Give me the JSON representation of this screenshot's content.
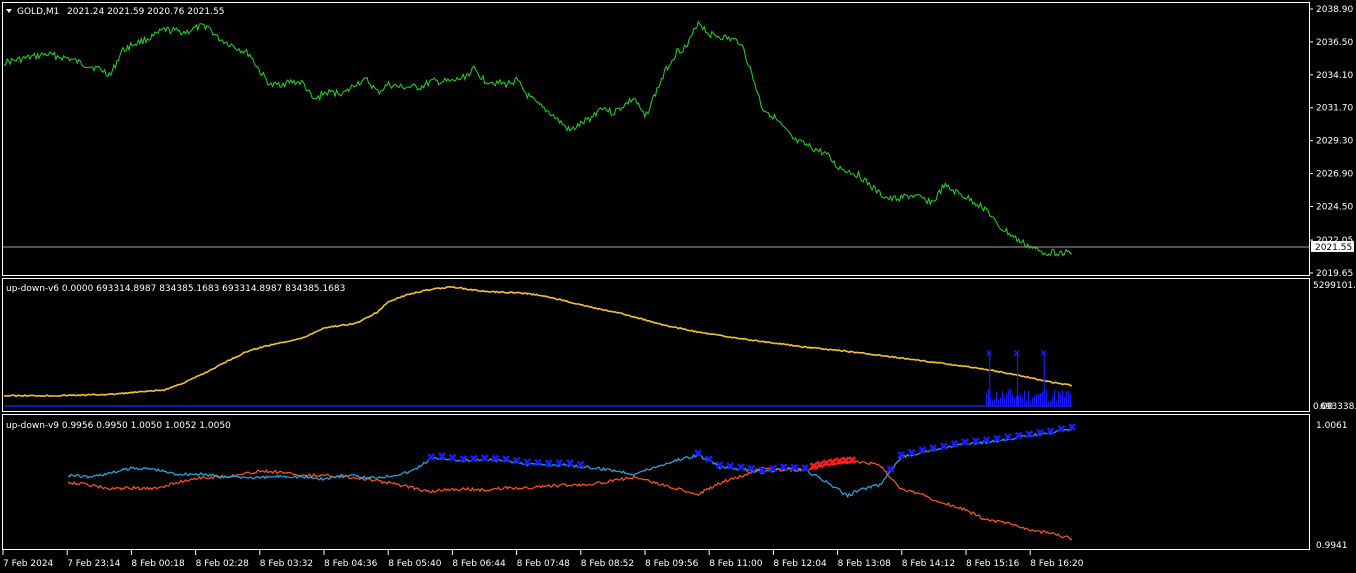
{
  "colors": {
    "background": "#000000",
    "frame": "#ffffff",
    "price_line": "#1fd81f",
    "yellow_line": "#f2c233",
    "blue_marker": "#1a1aff",
    "sky_line": "#29a8e6",
    "orange_line": "#ff5520",
    "red_marker": "#ff1a1a",
    "current_price_label_bg": "#ffffff"
  },
  "chart_data": [
    {
      "type": "line",
      "panel": "main",
      "header": {
        "symbol": "GOLD,M1",
        "ohlc": "2021.24 2021.59 2020.76 2021.55"
      },
      "current_price": "2021.55",
      "y_ticks": [
        "2038.90",
        "2036.50",
        "2034.10",
        "2031.70",
        "2029.30",
        "2026.90",
        "2024.50",
        "2022.05",
        "2019.65"
      ],
      "ylim": [
        2019.65,
        2038.9
      ],
      "x": [
        0,
        2,
        4,
        6,
        7,
        9,
        10,
        11,
        12,
        14,
        15,
        16,
        17,
        18,
        19,
        20,
        22,
        23,
        24,
        25,
        27,
        28,
        29,
        30,
        32,
        33,
        34,
        35,
        36,
        37,
        39,
        40,
        42,
        43,
        44,
        45,
        47,
        48,
        49,
        50,
        51,
        53,
        55,
        56,
        57,
        59,
        60,
        62,
        63,
        64,
        65,
        66,
        67,
        69,
        70,
        71,
        72,
        73,
        74,
        75,
        77,
        78,
        80,
        82,
        83,
        85,
        87,
        88,
        90,
        92,
        93,
        94,
        95,
        97,
        100
      ],
      "values": [
        2035.0,
        2035.3,
        2035.6,
        2035.3,
        2035.0,
        2034.5,
        2034.1,
        2035.8,
        2036.3,
        2036.9,
        2037.4,
        2037.3,
        2037.2,
        2037.5,
        2037.7,
        2036.8,
        2036.0,
        2035.6,
        2034.3,
        2033.3,
        2033.6,
        2033.5,
        2032.2,
        2032.8,
        2032.8,
        2033.5,
        2033.7,
        2032.8,
        2033.4,
        2033.2,
        2033.2,
        2033.6,
        2033.6,
        2033.9,
        2034.5,
        2033.7,
        2033.4,
        2033.7,
        2032.6,
        2031.9,
        2031.4,
        2030.0,
        2031.0,
        2031.8,
        2031.3,
        2032.4,
        2031.0,
        2034.5,
        2035.8,
        2036.2,
        2038.0,
        2037.1,
        2036.9,
        2036.5,
        2034.2,
        2031.7,
        2031.1,
        2030.2,
        2029.3,
        2029.0,
        2028.3,
        2027.4,
        2026.8,
        2025.4,
        2025.0,
        2025.3,
        2024.8,
        2026.0,
        2025.2,
        2024.3,
        2023.1,
        2022.6,
        2022.0,
        2021.2,
        2021.1
      ]
    },
    {
      "type": "line",
      "panel": "indicator-1",
      "header": "up-down-v6 0.0000 693314.8987 834385.1683 693314.8987 834385.1683",
      "y_ticks": [
        "5299101.9",
        "0.00",
        "693338.1"
      ],
      "ylim": [
        0,
        5299101.9
      ],
      "series": [
        {
          "x": [
            0,
            5,
            10,
            15,
            17,
            19,
            21,
            23,
            25,
            28,
            30,
            33,
            35,
            36,
            38,
            40,
            42,
            45,
            48,
            50,
            52,
            55,
            58,
            60,
            62,
            65,
            70,
            75,
            80,
            85,
            90,
            92,
            95,
            98,
            100
          ],
          "values": [
            500000,
            500000,
            560000,
            750000,
            1100000,
            1550000,
            2050000,
            2500000,
            2750000,
            3050000,
            3500000,
            3700000,
            4200000,
            4650000,
            5000000,
            5200000,
            5300000,
            5100000,
            5050000,
            4950000,
            4750000,
            4400000,
            4100000,
            3850000,
            3600000,
            3300000,
            2950000,
            2650000,
            2400000,
            2100000,
            1800000,
            1650000,
            1400000,
            1100000,
            950000
          ]
        }
      ],
      "markers": {
        "x": [
          92.3,
          94.9,
          97.4
        ],
        "label": "x"
      }
    },
    {
      "type": "line",
      "panel": "indicator-2",
      "header": "up-down-v9 0.9956 0.9950 1.0050 1.0052 1.0050",
      "y_ticks": [
        "1.0061",
        "0.9941"
      ],
      "ylim": [
        0.9941,
        1.0061
      ],
      "series": [
        {
          "x": [
            6,
            8,
            10,
            12,
            14,
            16,
            18,
            20,
            22,
            24,
            26,
            28,
            30,
            32,
            34,
            36,
            38,
            40,
            41,
            43,
            45,
            47,
            49,
            51,
            53,
            55,
            57,
            59,
            61,
            63,
            65,
            67,
            69,
            71,
            73,
            75,
            77,
            79,
            80,
            82,
            84,
            86,
            88,
            90,
            92,
            94,
            96,
            98,
            100
          ],
          "values": [
            1.0011,
            1.0009,
            1.0013,
            1.0018,
            1.0017,
            1.0012,
            1.0012,
            1.001,
            1.0009,
            1.0008,
            1.001,
            1.0009,
            1.0007,
            1.0011,
            1.0008,
            1.001,
            1.0014,
            1.0027,
            1.0028,
            1.0025,
            1.0026,
            1.0025,
            1.0022,
            1.0021,
            1.0021,
            1.0018,
            1.0016,
            1.0012,
            1.0019,
            1.0026,
            1.0031,
            1.0019,
            1.0017,
            1.0014,
            1.0017,
            1.0016,
            1.0004,
            0.999,
            0.9996,
            1.0001,
            1.0029,
            1.0034,
            1.0038,
            1.0042,
            1.0044,
            1.0047,
            1.005,
            1.0053,
            1.0057
          ]
        },
        {
          "x": [
            6,
            8,
            10,
            12,
            14,
            16,
            18,
            20,
            22,
            24,
            26,
            28,
            30,
            32,
            34,
            36,
            38,
            40,
            41,
            43,
            45,
            47,
            49,
            51,
            53,
            55,
            57,
            59,
            61,
            63,
            65,
            67,
            69,
            71,
            73,
            75,
            77,
            79,
            80,
            82,
            84,
            86,
            88,
            90,
            92,
            94,
            96,
            98,
            100
          ],
          "values": [
            1.0004,
            1.0001,
            0.9997,
            0.9998,
            0.9997,
            1.0003,
            1.0008,
            1.0009,
            1.0011,
            1.0015,
            1.0014,
            1.001,
            1.0011,
            1.0009,
            1.0007,
            1.0003,
            0.9999,
            0.9994,
            0.9996,
            0.9997,
            0.9996,
            0.9998,
            0.9998,
            1.0,
            1.0001,
            1.0002,
            1.0005,
            1.0009,
            1.0003,
            0.9997,
            0.9992,
            1.0003,
            1.001,
            1.0018,
            1.0016,
            1.0016,
            1.0021,
            1.0024,
            1.0024,
            1.0021,
            0.9997,
            0.9991,
            0.9983,
            0.9976,
            0.9966,
            0.9963,
            0.9956,
            0.9953,
            0.9947
          ]
        }
      ],
      "blue_markers": {
        "x": [
          40,
          41,
          42,
          43,
          44,
          45,
          46,
          47,
          48,
          49,
          50,
          51,
          52,
          53,
          54,
          65,
          66,
          67,
          68,
          69,
          70,
          71,
          72,
          73,
          74,
          75,
          83,
          84,
          85,
          86,
          87,
          88,
          89,
          90,
          91,
          92,
          93,
          94,
          95,
          96,
          97,
          98,
          99,
          100
        ]
      },
      "red_markers": {
        "x": [
          75.8,
          76.4,
          77,
          77.6,
          78.2,
          78.8,
          79.4
        ]
      }
    }
  ],
  "x_ticks": [
    "7 Feb 2024",
    "7 Feb 23:14",
    "8 Feb 00:18",
    "8 Feb 02:28",
    "8 Feb 03:32",
    "8 Feb 04:36",
    "8 Feb 05:40",
    "8 Feb 06:44",
    "8 Feb 07:48",
    "8 Feb 08:52",
    "8 Feb 09:56",
    "8 Feb 11:00",
    "8 Feb 12:04",
    "8 Feb 13:08",
    "8 Feb 14:12",
    "8 Feb 15:16",
    "8 Feb 16:20"
  ]
}
